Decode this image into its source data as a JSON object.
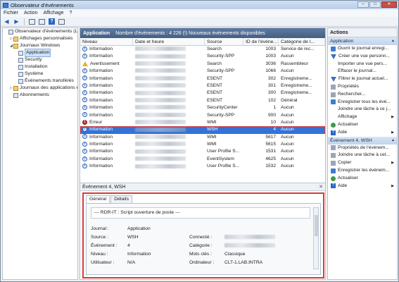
{
  "window": {
    "title": "Observateur d'événements"
  },
  "menu": [
    "Fichier",
    "Action",
    "Affichage",
    "?"
  ],
  "tree": [
    {
      "label": "Observateur d'événements (Local)",
      "depth": 0,
      "icon": "log",
      "expander": "",
      "selected": false
    },
    {
      "label": "Affichages personnalisés",
      "depth": 1,
      "icon": "folder",
      "expander": "▷",
      "selected": false
    },
    {
      "label": "Journaux Windows",
      "depth": 1,
      "icon": "folder",
      "expander": "◢",
      "selected": false
    },
    {
      "label": "Application",
      "depth": 2,
      "icon": "log",
      "expander": "",
      "selected": true
    },
    {
      "label": "Security",
      "depth": 2,
      "icon": "log",
      "expander": "",
      "selected": false
    },
    {
      "label": "Installation",
      "depth": 2,
      "icon": "log",
      "expander": "",
      "selected": false
    },
    {
      "label": "Système",
      "depth": 2,
      "icon": "log",
      "expander": "",
      "selected": false
    },
    {
      "label": "Événements transférés",
      "depth": 2,
      "icon": "log",
      "expander": "",
      "selected": false
    },
    {
      "label": "Journaux des applications et",
      "depth": 1,
      "icon": "folder",
      "expander": "▷",
      "selected": false
    },
    {
      "label": "Abonnements",
      "depth": 1,
      "icon": "log",
      "expander": "",
      "selected": false
    }
  ],
  "list": {
    "log_name": "Application",
    "summary": "Nombre d'événements : 4 226 (!) Nouveaux événements disponibles",
    "columns": [
      "Niveau",
      "Date et heure",
      "Source",
      "ID de l'événe...",
      "Catégorie de l..."
    ],
    "rows": [
      {
        "level": "Information",
        "type": "info",
        "source": "Search",
        "id": "1003",
        "category": "Service de rec...",
        "highlight": false
      },
      {
        "level": "Information",
        "type": "info",
        "source": "Security-SPP",
        "id": "1003",
        "category": "Aucun",
        "highlight": false
      },
      {
        "level": "Avertissement",
        "type": "warn",
        "source": "Search",
        "id": "3036",
        "category": "Rassembleur",
        "highlight": false
      },
      {
        "level": "Information",
        "type": "info",
        "source": "Security-SPP",
        "id": "1066",
        "category": "Aucun",
        "highlight": false
      },
      {
        "level": "Information",
        "type": "info",
        "source": "ESENT",
        "id": "302",
        "category": "Enregistreme...",
        "highlight": false
      },
      {
        "level": "Information",
        "type": "info",
        "source": "ESENT",
        "id": "301",
        "category": "Enregistreme...",
        "highlight": false
      },
      {
        "level": "Information",
        "type": "info",
        "source": "ESENT",
        "id": "300",
        "category": "Enregistreme...",
        "highlight": false
      },
      {
        "level": "Information",
        "type": "info",
        "source": "ESENT",
        "id": "102",
        "category": "Général",
        "highlight": false
      },
      {
        "level": "Information",
        "type": "info",
        "source": "SecurityCenter",
        "id": "1",
        "category": "Aucun",
        "highlight": false
      },
      {
        "level": "Information",
        "type": "info",
        "source": "Security-SPP",
        "id": "900",
        "category": "Aucun",
        "highlight": false
      },
      {
        "level": "Erreur",
        "type": "err",
        "source": "WMI",
        "id": "10",
        "category": "Aucun",
        "highlight": false
      },
      {
        "level": "Information",
        "type": "info",
        "source": "WSH",
        "id": "4",
        "category": "Aucun",
        "highlight": true
      },
      {
        "level": "Information",
        "type": "info",
        "source": "WMI",
        "id": "5617",
        "category": "Aucun",
        "highlight": false
      },
      {
        "level": "Information",
        "type": "info",
        "source": "WMI",
        "id": "5615",
        "category": "Aucun",
        "highlight": false
      },
      {
        "level": "Information",
        "type": "info",
        "source": "User Profile S...",
        "id": "1531",
        "category": "Aucun",
        "highlight": false
      },
      {
        "level": "Information",
        "type": "info",
        "source": "EventSystem",
        "id": "4625",
        "category": "Aucun",
        "highlight": false
      },
      {
        "level": "Information",
        "type": "info",
        "source": "User Profile S...",
        "id": "1532",
        "category": "Aucun",
        "highlight": false
      }
    ]
  },
  "detail": {
    "title": "Événement 4, WSH",
    "tabs": [
      "Général",
      "Détails"
    ],
    "message": "--- RDR-IT : Script ouverture de poste ---",
    "labels": {
      "journal": "Journal :",
      "source": "Source :",
      "event": "Événement :",
      "level": "Niveau :",
      "user": "Utilisateur :",
      "logged": "Connecté :",
      "category": "Catégorie :",
      "keywords": "Mots clés :",
      "computer": "Ordinateur :"
    },
    "values": {
      "journal": "Application",
      "source": "WSH",
      "event": "4",
      "level": "Information",
      "user": "N/A",
      "keywords": "Classique",
      "computer": "CLT-1.LAB.INTRA"
    }
  },
  "actions": {
    "title": "Actions",
    "section1": "Application",
    "items1": [
      {
        "label": "Ouvrir le journal enregi...",
        "icon": "blue",
        "submenu": false
      },
      {
        "label": "Créer une vue personn...",
        "icon": "filter",
        "submenu": false
      },
      {
        "label": "Importer une vue pers...",
        "icon": "none",
        "submenu": false
      },
      {
        "label": "Effacer le journal...",
        "icon": "none",
        "submenu": false
      },
      {
        "label": "Filtrer le journal actuel...",
        "icon": "filter",
        "submenu": false
      },
      {
        "label": "Propriétés",
        "icon": "gray",
        "submenu": false
      },
      {
        "label": "Rechercher...",
        "icon": "gray",
        "submenu": false
      },
      {
        "label": "Enregistrer tous les évé...",
        "icon": "blue",
        "submenu": false
      },
      {
        "label": "Joindre une tâche à ce j...",
        "icon": "none",
        "submenu": false
      },
      {
        "label": "Affichage",
        "icon": "none",
        "submenu": true
      },
      {
        "label": "Actualiser",
        "icon": "green",
        "submenu": false
      },
      {
        "label": "Aide",
        "icon": "help",
        "submenu": true
      }
    ],
    "section2": "Événement 4, WSH",
    "items2": [
      {
        "label": "Propriétés de l'événem...",
        "icon": "gray",
        "submenu": false
      },
      {
        "label": "Joindre une tâche à cet...",
        "icon": "gray",
        "submenu": false
      },
      {
        "label": "Copier",
        "icon": "gray",
        "submenu": true
      },
      {
        "label": "Enregistrer les événem...",
        "icon": "blue",
        "submenu": false
      },
      {
        "label": "Actualiser",
        "icon": "green",
        "submenu": false
      },
      {
        "label": "Aide",
        "icon": "help",
        "submenu": true
      }
    ]
  }
}
